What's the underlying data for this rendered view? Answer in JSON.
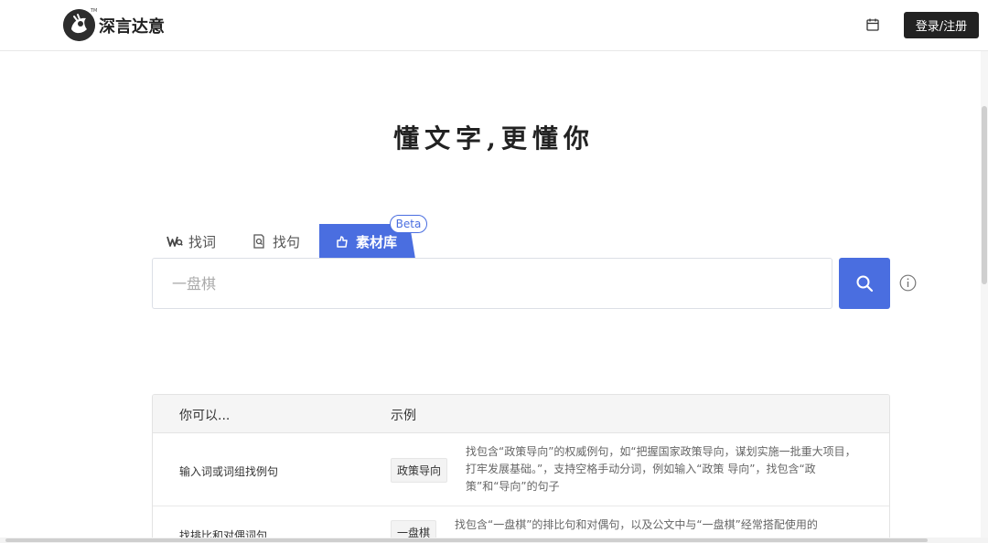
{
  "header": {
    "logo_text": "深言达意",
    "logo_tm": "TM",
    "login_label": "登录/注册"
  },
  "slogan": "懂文字,更懂你",
  "tabs": [
    {
      "label": "找词",
      "icon": "word-search-icon"
    },
    {
      "label": "找句",
      "icon": "sentence-search-icon"
    },
    {
      "label": "素材库",
      "icon": "library-icon",
      "active": true
    }
  ],
  "beta_label": "Beta",
  "search": {
    "placeholder": "一盘棋"
  },
  "table": {
    "header_col1": "你可以...",
    "header_col2": "示例",
    "rows": [
      {
        "what": "输入词或词组找例句",
        "example": "政策导向",
        "description": "找包含“政策导向”的权威例句，如“把握国家政策导向，谋划实施一批重大项目，打牢发展基础。”，支持空格手动分词，例如输入“政策 导向”，找包含“政策”和“导向”的句子"
      },
      {
        "what": "找排比和对偶词句",
        "example": "一盘棋",
        "description": "找包含“一盘棋”的排比句和对偶句，以及公文中与“一盘棋”经常搭配使用的"
      }
    ]
  },
  "colors": {
    "accent": "#4a6ee0",
    "dark": "#222222"
  }
}
